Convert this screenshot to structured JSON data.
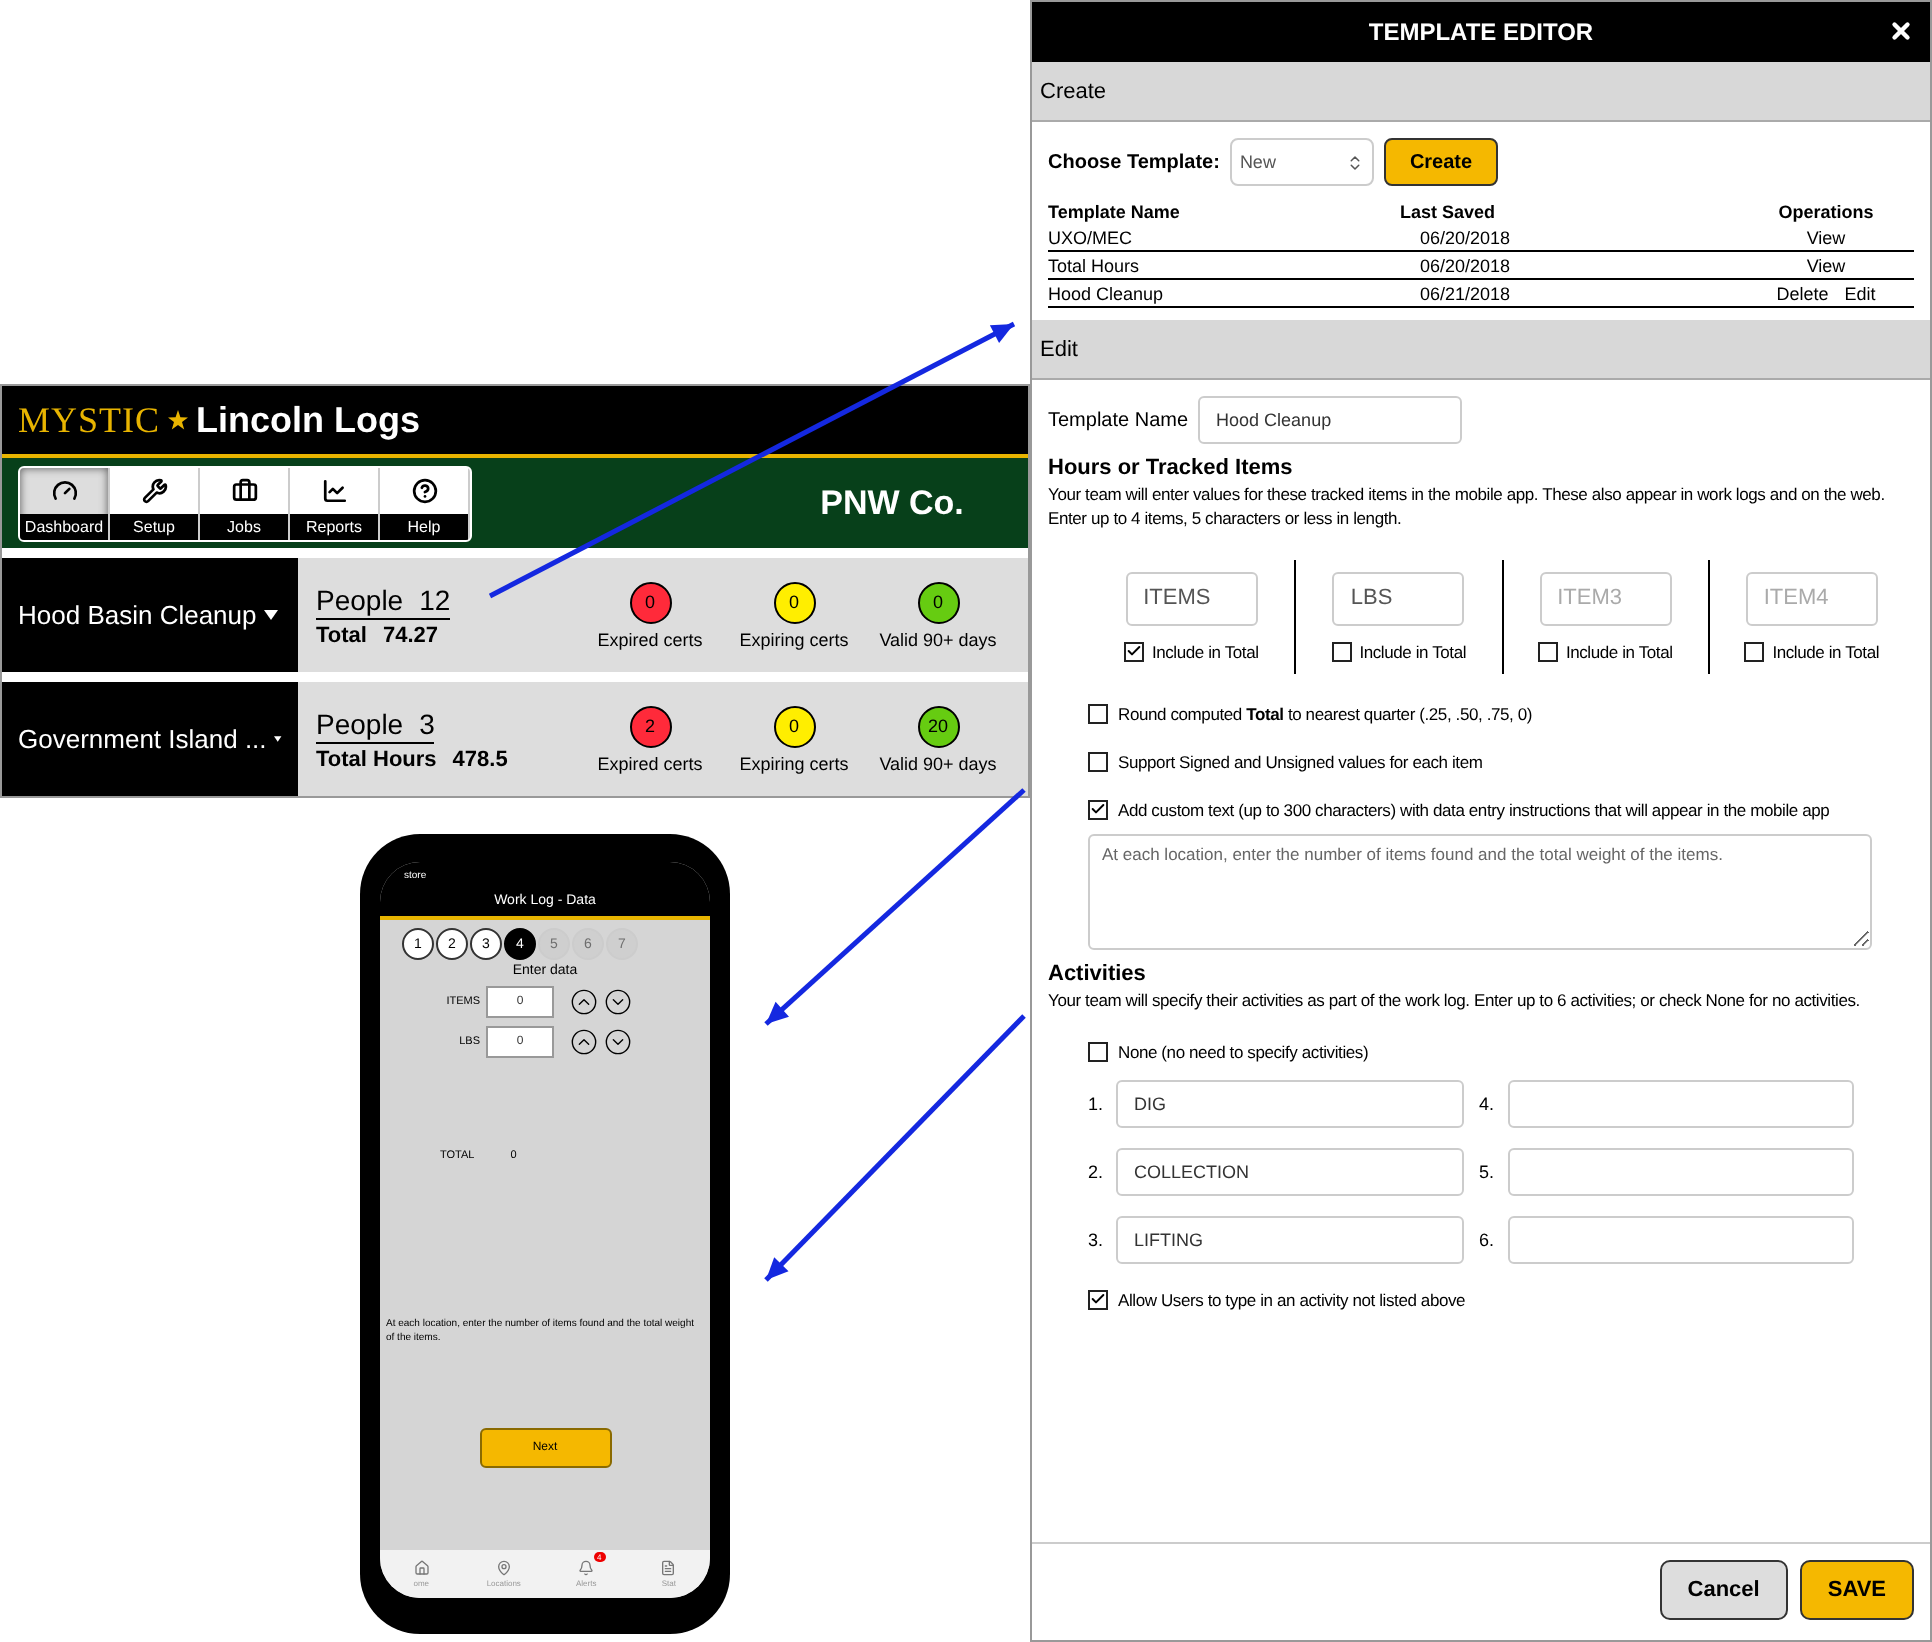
{
  "dashboard": {
    "brand": "MYSTIC",
    "app_title": "Lincoln Logs",
    "nav": [
      {
        "label": "Dashboard",
        "selected": true
      },
      {
        "label": "Setup",
        "selected": false
      },
      {
        "label": "Jobs",
        "selected": false
      },
      {
        "label": "Reports",
        "selected": false
      },
      {
        "label": "Help",
        "selected": false
      }
    ],
    "company": "PNW Co.",
    "jobs": [
      {
        "name": "Hood Basin Cleanup",
        "people_label": "People",
        "people": "12",
        "total_label": "Total",
        "total": "74.27",
        "certs": [
          {
            "count": "0",
            "label": "Expired certs",
            "color": "#ff2a3a"
          },
          {
            "count": "0",
            "label": "Expiring certs",
            "color": "#ffee00"
          },
          {
            "count": "0",
            "label": "Valid 90+ days",
            "color": "#66cc11"
          }
        ]
      },
      {
        "name": "Government Island ...",
        "people_label": "People",
        "people": "3",
        "total_label": "Total Hours",
        "total": "478.5",
        "certs": [
          {
            "count": "2",
            "label": "Expired certs",
            "color": "#ff2a3a"
          },
          {
            "count": "0",
            "label": "Expiring certs",
            "color": "#ffee00"
          },
          {
            "count": "20",
            "label": "Valid 90+ days",
            "color": "#66cc11"
          }
        ]
      }
    ]
  },
  "phone": {
    "carrier": "store",
    "title": "Work Log - Data",
    "steps": [
      {
        "label": "1",
        "kind": "done"
      },
      {
        "label": "2",
        "kind": "done"
      },
      {
        "label": "3",
        "kind": "done"
      },
      {
        "label": "4",
        "kind": "current"
      },
      {
        "label": "5",
        "kind": "upcoming"
      },
      {
        "label": "6",
        "kind": "upcoming"
      },
      {
        "label": "7",
        "kind": "upcoming"
      }
    ],
    "subtitle": "Enter data",
    "fields": [
      {
        "label": "ITEMS",
        "value": "0"
      },
      {
        "label": "LBS",
        "value": "0"
      }
    ],
    "total_label": "TOTAL",
    "total": "0",
    "note": "At each location, enter the number of items found and the total weight of the items.",
    "next": "Next",
    "tabs": [
      {
        "label": "ome"
      },
      {
        "label": "Locations"
      },
      {
        "label": "Alerts",
        "badge": "4"
      },
      {
        "label": "Stat"
      }
    ]
  },
  "editor": {
    "title": "TEMPLATE EDITOR",
    "create_section": "Create",
    "choose_label": "Choose Template:",
    "choose_value": "New",
    "create_button": "Create",
    "columns": [
      "Template Name",
      "Last Saved",
      "Operations"
    ],
    "rows": [
      {
        "name": "UXO/MEC",
        "saved": "06/20/2018",
        "operations": [
          "View"
        ]
      },
      {
        "name": "Total Hours",
        "saved": "06/20/2018",
        "operations": [
          "View"
        ]
      },
      {
        "name": "Hood Cleanup",
        "saved": "06/21/2018",
        "operations": [
          "Delete",
          "Edit"
        ]
      }
    ],
    "edit_section": "Edit",
    "template_name_label": "Template Name",
    "template_name": "Hood Cleanup",
    "tracked_heading": "Hours or Tracked Items",
    "tracked_description": "Your team will enter values for these tracked items in the mobile app. These also appear in work logs and on the web. Enter up to 4 items, 5 characters or less in length.",
    "items": [
      {
        "value": "ITEMS",
        "include_label": "Include in Total",
        "checked": true
      },
      {
        "value": "LBS",
        "include_label": "Include in Total",
        "checked": false
      },
      {
        "placeholder": "ITEM3",
        "include_label": "Include in Total",
        "checked": false
      },
      {
        "placeholder": "ITEM4",
        "include_label": "Include in Total",
        "checked": false
      }
    ],
    "options": [
      {
        "label": "Round computed **Total** to nearest quarter (.25, .50, .75, 0)",
        "checked": false
      },
      {
        "label": "Support Signed and Unsigned values for each item",
        "checked": false
      },
      {
        "label": "Add custom text (up to 300 characters) with data entry instructions that will appear in the mobile app",
        "checked": true
      }
    ],
    "custom_text": "At each location, enter the number of items found and the total weight of the items.",
    "activities_heading": "Activities",
    "activities_description": "Your team will specify their activities as part of the work log. Enter up to 6 activities; or check None for no activities.",
    "none_option": {
      "label": "None (no need to specify activities)",
      "checked": false
    },
    "activities": [
      {
        "number": "1.",
        "value": "DIG"
      },
      {
        "number": "4."
      },
      {
        "number": "2.",
        "value": "COLLECTION"
      },
      {
        "number": "5."
      },
      {
        "number": "3.",
        "value": "LIFTING"
      },
      {
        "number": "6."
      }
    ],
    "allow_option": {
      "label": "Allow Users to type in an activity not listed above",
      "checked": true
    },
    "cancel": "Cancel",
    "save": "SAVE"
  }
}
